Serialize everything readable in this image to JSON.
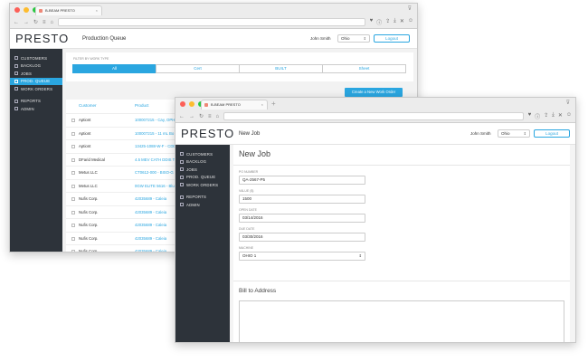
{
  "browser_back": {
    "tab_title": "B-BEAM PRESTO"
  },
  "browser_front": {
    "tab_title": "B-BEAM PRESTO"
  },
  "app": {
    "logo": "PRESTO",
    "user_name": "John Smith",
    "location": "Ohio",
    "logout": "Logout"
  },
  "back": {
    "page_title": "Production Queue",
    "sidebar": {
      "customers": "CUSTOMERS",
      "backlog": "BACKLOG",
      "jobs": "JOBS",
      "prod_queue": "PROD. QUEUE",
      "work_orders": "WORK ORDERS",
      "reports": "REPORTS",
      "admin": "ADMIN"
    },
    "filter_label": "FILTER BY WORK TYPE",
    "filters": [
      "All",
      "Cert",
      "BUILT",
      "Sheet"
    ],
    "new_work_order": "Create a New Work Order",
    "col_customer": "Customer",
    "col_product": "Product",
    "rows": [
      {
        "customer": "Aptiont",
        "product": "100007215 - Cay, OPH"
      },
      {
        "customer": "Aptiont",
        "product": "100007215 - 11 mL Bo"
      },
      {
        "customer": "Aptiont",
        "product": "13425-1088-W-F - CDD"
      },
      {
        "customer": "DFarid Medical",
        "product": "4.5 MEV CATH DDIS T"
      },
      {
        "customer": "Metus LLC",
        "product": "CT0612-000 - BISO-G"
      },
      {
        "customer": "Metus LLC",
        "product": "0GW ELITE 5616 - Blue"
      },
      {
        "customer": "Nufis Corp.",
        "product": "42035689 - Caleia"
      },
      {
        "customer": "Nufis Corp.",
        "product": "42035689 - Caleia"
      },
      {
        "customer": "Nufis Corp.",
        "product": "42035689 - Caleia"
      },
      {
        "customer": "Nufis Corp.",
        "product": "42035689 - Caleia"
      },
      {
        "customer": "Nufis Corp.",
        "product": "42035689 - Caleia"
      },
      {
        "customer": "Nufis Corp.",
        "product": "42040289 - Caleia"
      }
    ]
  },
  "front": {
    "page_title": "New Job",
    "sidebar": {
      "customers": "CUSTOMERS",
      "backlog": "BACKLOG",
      "jobs": "JOBS",
      "prod_queue": "PROD. QUEUE",
      "work_orders": "WORK ORDERS",
      "reports": "REPORTS",
      "admin": "ADMIN"
    },
    "heading": "New Job",
    "po_label": "PO NUMBER",
    "po_value": "QA-2567-P5",
    "value_label": "VALUE ($)",
    "value_value": "1500",
    "open_label": "OPEN DATE",
    "open_value": "03/14/2016",
    "due_label": "DUE DATE",
    "due_value": "03/30/2016",
    "machine_label": "MACHINE",
    "machine_value": "OHIO 1",
    "bill_to": "Bill to Address"
  },
  "colors": {
    "accent": "#2aa6e0",
    "sidebar": "#2d333a"
  }
}
